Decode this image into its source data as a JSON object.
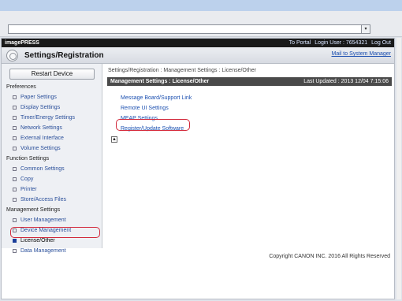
{
  "browser": {
    "dropdown_glyph": "▾"
  },
  "header": {
    "brand": "imagePRESS",
    "to_portal": "To Portal",
    "login_user": "Login User : 7654321",
    "logout": "Log Out"
  },
  "subheader": {
    "title": "Settings/Registration",
    "mail": "Mail to System Manager"
  },
  "sidebar": {
    "restart": "Restart Device",
    "preferences_title": "Preferences",
    "preferences": [
      "Paper Settings",
      "Display Settings",
      "Timer/Energy Settings",
      "Network Settings",
      "External Interface",
      "Volume Settings"
    ],
    "function_title": "Function Settings",
    "function": [
      "Common Settings",
      "Copy",
      "Printer",
      "Store/Access Files"
    ],
    "management_title": "Management Settings",
    "management": [
      "User Management",
      "Device Management",
      "License/Other",
      "Data Management"
    ]
  },
  "content": {
    "breadcrumb": "Settings/Registration : Management Settings : License/Other",
    "section_title": "Management Settings : License/Other",
    "last_updated": "Last Updated : 2013 12/04 7:15:06",
    "links": [
      "Message Board/Support Link",
      "Remote UI Settings",
      "MEAP Settings",
      "Register/Update Software"
    ],
    "up_icon": "▲"
  },
  "footer": {
    "copyright": "Copyright CANON INC. 2016 All Rights Reserved"
  }
}
